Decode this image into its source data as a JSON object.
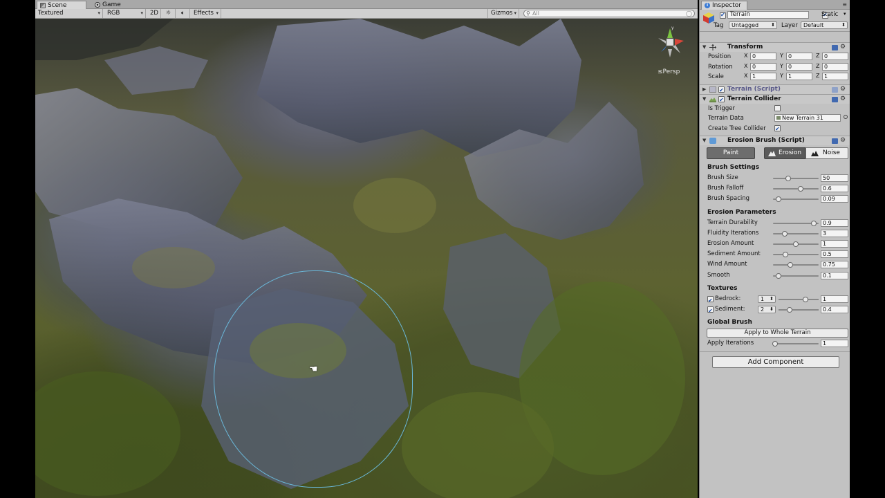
{
  "scene_tabs": [
    {
      "label": "Scene",
      "active": true
    },
    {
      "label": "Game",
      "active": false
    }
  ],
  "scene_toolbar": {
    "shading": "Textured",
    "render_mode": "RGB",
    "mode_2d": "2D",
    "effects": "Effects",
    "gizmos": "Gizmos",
    "search_placeholder": "All"
  },
  "viewport": {
    "projection_label": "≤Persp",
    "gizmo_axis": "y"
  },
  "inspector": {
    "tab_label": "Inspector",
    "object_name": "Terrain",
    "static_label": "Static",
    "tag_label": "Tag",
    "tag_value": "Untagged",
    "layer_label": "Layer",
    "layer_value": "Default"
  },
  "transform": {
    "title": "Transform",
    "position_label": "Position",
    "rotation_label": "Rotation",
    "scale_label": "Scale",
    "position": {
      "x": "0",
      "y": "0",
      "z": "0"
    },
    "rotation": {
      "x": "0",
      "y": "0",
      "z": "0"
    },
    "scale": {
      "x": "1",
      "y": "1",
      "z": "1"
    }
  },
  "terrain_script": {
    "title": "Terrain (Script)"
  },
  "terrain_collider": {
    "title": "Terrain Collider",
    "is_trigger_label": "Is Trigger",
    "is_trigger": false,
    "terrain_data_label": "Terrain Data",
    "terrain_data_value": "New Terrain 31",
    "create_tree_label": "Create Tree Collider",
    "create_tree": true
  },
  "erosion_brush": {
    "title": "Erosion Brush (Script)",
    "paint_label": "Paint",
    "erosion_label": "Erosion",
    "noise_label": "Noise",
    "brush_settings_title": "Brush Settings",
    "brush_settings": [
      {
        "label": "Brush Size",
        "value": "50",
        "fraction": 0.33
      },
      {
        "label": "Brush Falloff",
        "value": "0.6",
        "fraction": 0.6
      },
      {
        "label": "Brush Spacing",
        "value": "0.09",
        "fraction": 0.12
      }
    ],
    "erosion_params_title": "Erosion Parameters",
    "erosion_params": [
      {
        "label": "Terrain Durability",
        "value": "0.9",
        "fraction": 0.9
      },
      {
        "label": "Fluidity Iterations",
        "value": "3",
        "fraction": 0.25
      },
      {
        "label": "Erosion Amount",
        "value": "1",
        "fraction": 0.5
      },
      {
        "label": "Sediment Amount",
        "value": "0.5",
        "fraction": 0.27
      },
      {
        "label": "Wind Amount",
        "value": "0.75",
        "fraction": 0.38
      },
      {
        "label": "Smooth",
        "value": "0.1",
        "fraction": 0.12
      }
    ],
    "textures_title": "Textures",
    "textures": [
      {
        "label": "Bedrock:",
        "channel": "1",
        "value": "1",
        "fraction": 0.68,
        "checked": true
      },
      {
        "label": "Sediment:",
        "channel": "2",
        "value": "0.4",
        "fraction": 0.28,
        "checked": true
      }
    ],
    "global_brush_title": "Global Brush",
    "apply_button": "Apply to Whole Terrain",
    "apply_iterations_label": "Apply Iterations",
    "apply_iterations_value": "1",
    "apply_iterations_fraction": 0.04
  },
  "add_component_label": "Add Component",
  "colors": {
    "brush_ring": "#6ab8d9",
    "paint_button": "#6d6d6d",
    "panel_bg": "#c2c2c2"
  }
}
